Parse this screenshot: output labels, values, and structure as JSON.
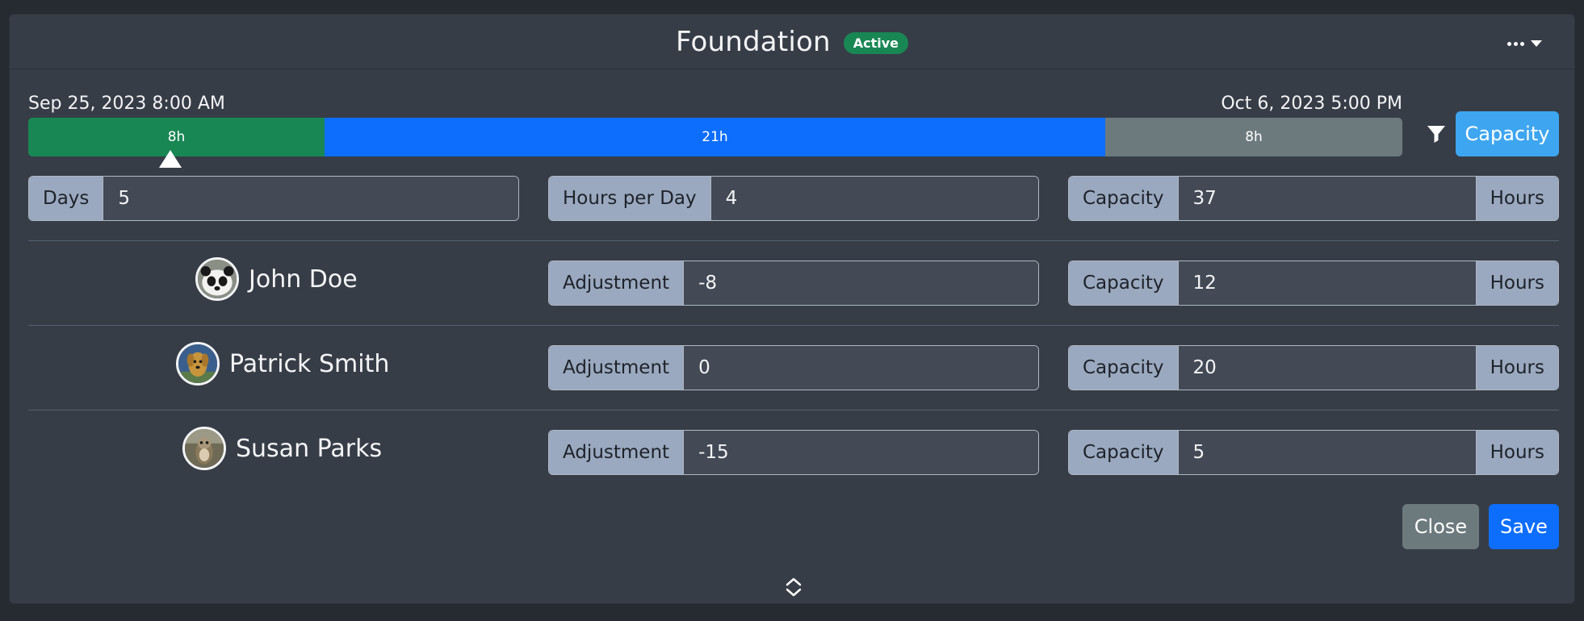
{
  "header": {
    "title": "Foundation",
    "status_badge": "Active"
  },
  "timeline": {
    "start_label": "Sep 25, 2023 8:00 AM",
    "end_label": "Oct 6, 2023 5:00 PM",
    "segments": [
      {
        "label": "8h",
        "color": "#198754"
      },
      {
        "label": "21h",
        "color": "#0d6efd"
      },
      {
        "label": "8h",
        "color": "#6c7a7e"
      }
    ]
  },
  "toolbar": {
    "capacity_button": "Capacity"
  },
  "summary": {
    "days_label": "Days",
    "days_value": "5",
    "hours_per_day_label": "Hours per Day",
    "hours_per_day_value": "4",
    "capacity_label": "Capacity",
    "capacity_value": "37",
    "capacity_unit": "Hours"
  },
  "members": [
    {
      "name": "John Doe",
      "adjustment_label": "Adjustment",
      "adjustment": "-8",
      "capacity_label": "Capacity",
      "capacity": "12",
      "unit": "Hours"
    },
    {
      "name": "Patrick Smith",
      "adjustment_label": "Adjustment",
      "adjustment": "0",
      "capacity_label": "Capacity",
      "capacity": "20",
      "unit": "Hours"
    },
    {
      "name": "Susan Parks",
      "adjustment_label": "Adjustment",
      "adjustment": "-15",
      "capacity_label": "Capacity",
      "capacity": "5",
      "unit": "Hours"
    }
  ],
  "footer": {
    "close_label": "Close",
    "save_label": "Save"
  },
  "icons": {
    "menu": "more-horizontal-icon",
    "filter": "filter-icon",
    "expand": "chevron-up-down-icon"
  },
  "colors": {
    "accent": "#0d6efd",
    "success": "#198754",
    "secondary": "#6c7a7e",
    "info": "#3ea6f0"
  }
}
